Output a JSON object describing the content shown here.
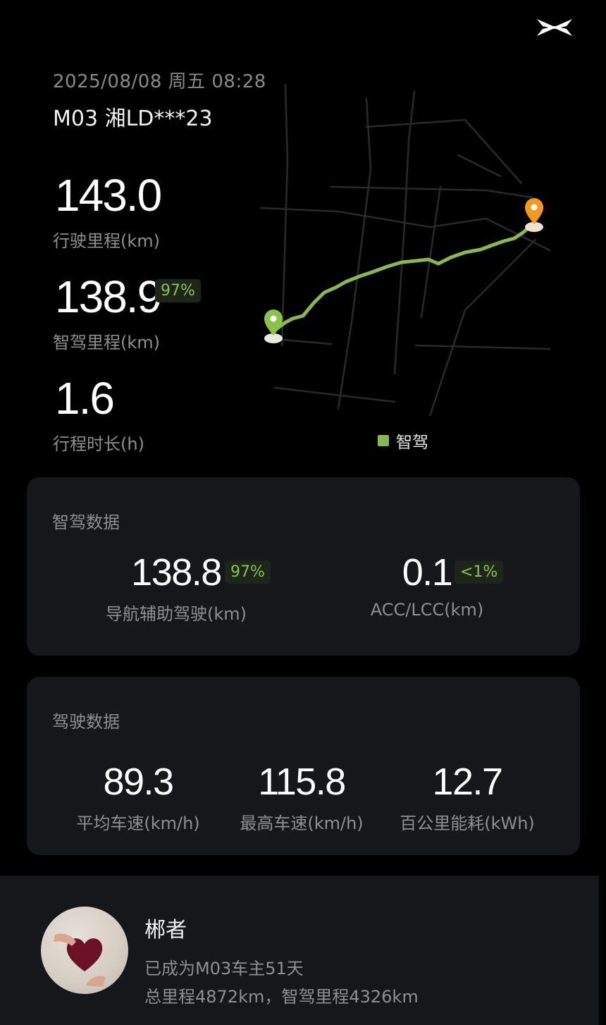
{
  "header": {
    "date": "2025/08/08 周五 08:28",
    "car": "M03 湘LD***23"
  },
  "trip": {
    "distance": "143.0",
    "distance_label": "行驶里程(km)",
    "smart_distance": "138.9",
    "smart_badge": "97%",
    "smart_label": "智驾里程(km)",
    "duration": "1.6",
    "duration_label": "行程时长(h)"
  },
  "map": {
    "legend_label": "智驾",
    "route_color": "#8bb84e",
    "start_color": "#8bc34a",
    "end_color": "#f39a1e"
  },
  "smart_card": {
    "title": "智驾数据",
    "nav_value": "138.8",
    "nav_badge": "97%",
    "nav_label": "导航辅助驾驶(km)",
    "acc_value": "0.1",
    "acc_badge": "<1%",
    "acc_label": "ACC/LCC(km)"
  },
  "drive_card": {
    "title": "驾驶数据",
    "items": [
      {
        "value": "89.3",
        "label": "平均车速(km/h)"
      },
      {
        "value": "115.8",
        "label": "最高车速(km/h)"
      },
      {
        "value": "12.7",
        "label": "百公里能耗(kWh)"
      }
    ]
  },
  "profile": {
    "name": "郴者",
    "line1": "已成为M03车主51天",
    "line2": "总里程4872km，智驾里程4326km"
  }
}
